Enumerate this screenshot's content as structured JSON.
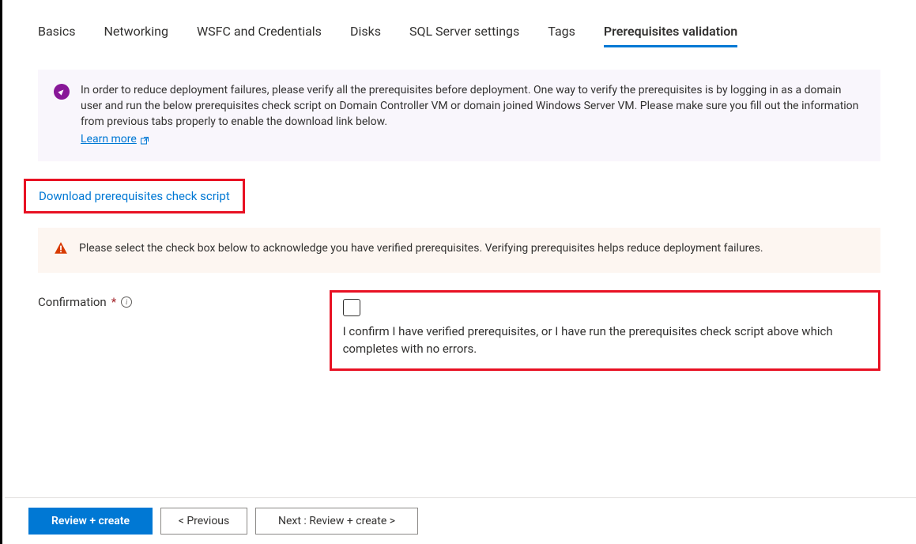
{
  "tabs": {
    "items": [
      {
        "label": "Basics"
      },
      {
        "label": "Networking"
      },
      {
        "label": "WSFC and Credentials"
      },
      {
        "label": "Disks"
      },
      {
        "label": "SQL Server settings"
      },
      {
        "label": "Tags"
      },
      {
        "label": "Prerequisites validation"
      }
    ],
    "active_index": 6
  },
  "info_box": {
    "text": "In order to reduce deployment failures, please verify all the prerequisites before deployment. One way to verify the prerequisites is by logging in as a domain user and run the below prerequisites check script on Domain Controller VM or domain joined Windows Server VM. Please make sure you fill out the information from previous tabs properly to enable the download link below.",
    "learn_more": "Learn more"
  },
  "download_link": "Download prerequisites check script",
  "warn_box": {
    "text": "Please select the check box below to acknowledge you have verified prerequisites. Verifying prerequisites helps reduce deployment failures."
  },
  "confirmation": {
    "label": "Confirmation",
    "required": "*",
    "checkbox_label": "I confirm I have verified prerequisites, or I have run the prerequisites check script above which completes with no errors."
  },
  "footer": {
    "review_create": "Review + create",
    "previous": "< Previous",
    "next": "Next : Review + create >"
  }
}
